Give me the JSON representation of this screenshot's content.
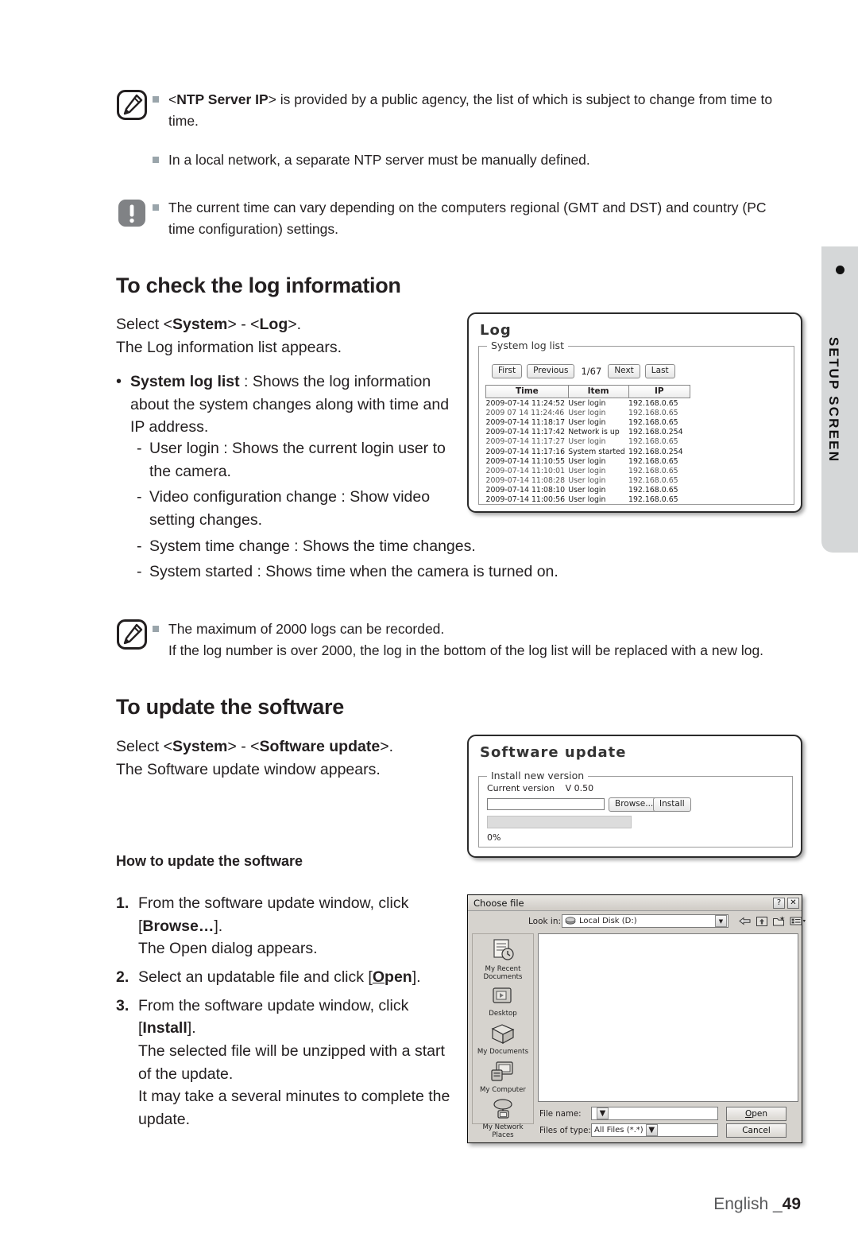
{
  "side_tab": {
    "label": "SETUP SCREEN"
  },
  "notes": [
    {
      "icon": "note-icon",
      "lines": [
        {
          "segments": [
            {
              "t": "<",
              "b": false
            },
            {
              "t": "NTP Server IP",
              "b": true
            },
            {
              "t": "> is provided by a public agency, the list of which is subject to change from time to time.",
              "b": false
            }
          ]
        },
        {
          "segments": [
            {
              "t": "In a local network, a separate NTP server must be manually defined.",
              "b": false
            }
          ]
        }
      ]
    },
    {
      "icon": "caution-icon",
      "lines": [
        {
          "segments": [
            {
              "t": "The current time can vary depending on the computers regional (GMT and DST) and country (PC time configuration) settings.",
              "b": false
            }
          ]
        }
      ]
    },
    {
      "icon": "note-icon",
      "lines": [
        {
          "segments": [
            {
              "t": "The maximum of 2000 logs can be recorded.",
              "b": false
            }
          ],
          "extra": "If the log number is over 2000, the log in the bottom of the log list will be replaced with a new log."
        }
      ]
    }
  ],
  "log_section": {
    "heading": "To check the log information",
    "intro_line1_pre": "Select <",
    "intro_line1_b1": "System",
    "intro_line1_mid": "> - <",
    "intro_line1_b2": "Log",
    "intro_line1_post": ">.",
    "intro_line2": "The Log information list appears.",
    "bullet_bold": "System log list",
    "bullet_rest": " : Shows the log information about the system changes along with time and IP address.",
    "dashes": [
      "User login : Shows the current login user to the camera.",
      "Video configuration change : Show video setting changes.",
      "System time change : Shows the time changes.",
      "System started : Shows time when the camera is turned on."
    ]
  },
  "update_section": {
    "heading": "To update the software",
    "intro_line1_pre": "Select <",
    "intro_line1_b1": "System",
    "intro_line1_mid": "> - <",
    "intro_line1_b2": "Software update",
    "intro_line1_post": ">.",
    "intro_line2": "The Software update window appears.",
    "howto_heading": "How to update the software",
    "steps": [
      {
        "num": "1.",
        "pre": "From the software update window, click [",
        "bold": "Browse…",
        "post": "].",
        "extra": [
          "The Open dialog appears."
        ]
      },
      {
        "num": "2.",
        "pre": "Select an updatable file and click [",
        "bold": "Open",
        "post": "].",
        "bold_underline_first": true,
        "extra": []
      },
      {
        "num": "3.",
        "pre": "From the software update window, click [",
        "bold": "Install",
        "post": "].",
        "extra": [
          "The selected file will be unzipped with a start of the update.",
          "It may take a several minutes to complete the update."
        ]
      }
    ]
  },
  "log_window": {
    "title": "Log",
    "fieldset_legend": "System log list",
    "pager": {
      "first": "First",
      "previous": "Previous",
      "count": "1/67",
      "next": "Next",
      "last": "Last"
    },
    "columns": [
      "Time",
      "Item",
      "IP"
    ],
    "rows": [
      {
        "time": "2009-07-14 11:24:52",
        "item": "User login",
        "ip": "192.168.0.65",
        "blur": false
      },
      {
        "time": "2009 07 14 11:24:46",
        "item": "User login",
        "ip": "192.168.0.65",
        "blur": true
      },
      {
        "time": "2009-07-14 11:18:17",
        "item": "User login",
        "ip": "192.168.0.65",
        "blur": false
      },
      {
        "time": "2009-07-14 11:17:42",
        "item": "Network is up",
        "ip": "192.168.0.254",
        "blur": false
      },
      {
        "time": "2009-07-14 11:17:27",
        "item": "User login",
        "ip": "192.168.0.65",
        "blur": true
      },
      {
        "time": "2009-07-14 11:17:16",
        "item": "System started",
        "ip": "192.168.0.254",
        "blur": false
      },
      {
        "time": "2009-07-14 11:10:55",
        "item": "User login",
        "ip": "192.168.0.65",
        "blur": false
      },
      {
        "time": "2009-07-14 11:10:01",
        "item": "User login",
        "ip": "192.168.0.65",
        "blur": true
      },
      {
        "time": "2009-07-14 11:08:28",
        "item": "User login",
        "ip": "192.168.0.65",
        "blur": true
      },
      {
        "time": "2009-07-14 11:08:10",
        "item": "User login",
        "ip": "192.168.0.65",
        "blur": false
      },
      {
        "time": "2009-07-14 11:00:56",
        "item": "User login",
        "ip": "192.168.0.65",
        "blur": false
      }
    ]
  },
  "software_window": {
    "title": "Software update",
    "fieldset_legend": "Install new version",
    "current_version_label": "Current version",
    "current_version_value": "V 0.50",
    "path_value": "",
    "browse_label": "Browse...",
    "install_label": "Install",
    "progress_label": "0%",
    "progress_percent": 0
  },
  "choose_file": {
    "title": "Choose file",
    "help_btn": "?",
    "close_btn": "✕",
    "lookin_label": "Look in:",
    "lookin_value": "Local Disk (D:)",
    "places": [
      "My Recent Documents",
      "Desktop",
      "My Documents",
      "My Computer",
      "My Network Places"
    ],
    "filename_label": "File name:",
    "filename_value": "",
    "filetype_label": "Files of type:",
    "filetype_value": "All Files (*.*)",
    "open_label": "Open",
    "cancel_label": "Cancel"
  },
  "footer": {
    "language": "English _",
    "page": "49"
  }
}
